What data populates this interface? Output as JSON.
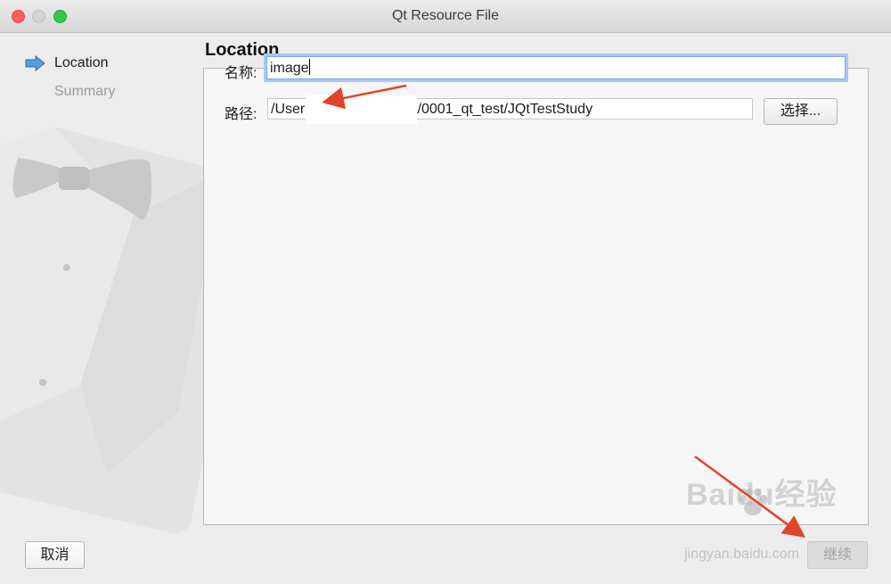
{
  "window": {
    "title": "Qt Resource File"
  },
  "steps": [
    {
      "label": "Location",
      "active": true
    },
    {
      "label": "Summary",
      "active": false
    }
  ],
  "page": {
    "heading": "Location"
  },
  "form": {
    "name_label": "名称:",
    "name_value": "image",
    "path_label": "路径:",
    "path_value": "/User                              nts/my_project/qt/0001_qt_test/JQtTestStudy",
    "browse_label": "选择..."
  },
  "buttons": {
    "cancel": "取消",
    "continue": "继续"
  },
  "watermark": {
    "brand": "Baidu经验",
    "url": "jingyan.baidu.com"
  },
  "colors": {
    "active_step_arrow": "#5b9bd5",
    "annotation_arrow": "#e0452a",
    "focus_ring": "#a9c8f2"
  }
}
